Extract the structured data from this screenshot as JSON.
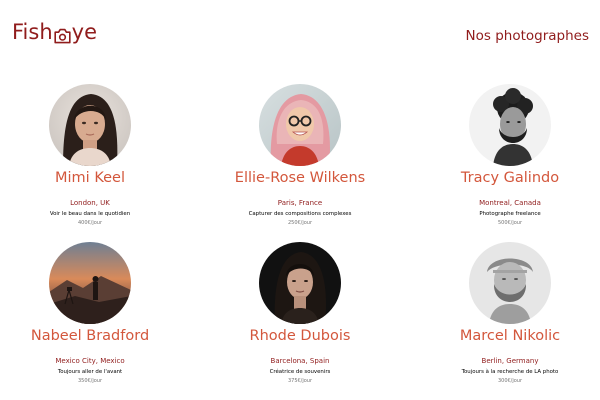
{
  "header": {
    "logo_text_before": "Fish",
    "logo_text_after": "ye",
    "logo_icon": "camera-icon",
    "tagline": "Nos photographes"
  },
  "photographers": [
    {
      "name": "Mimi Keel",
      "location": "London, UK",
      "tagline": "Voir le beau dans le quotidien",
      "price": "400€/jour",
      "portrait": "portrait-young-woman"
    },
    {
      "name": "Ellie-Rose Wilkens",
      "location": "Paris, France",
      "tagline": "Capturer des compositions complexes",
      "price": "250€/jour",
      "portrait": "portrait-woman-glasses-pink-hair"
    },
    {
      "name": "Tracy Galindo",
      "location": "Montreal, Canada",
      "tagline": "Photographe freelance",
      "price": "500€/jour",
      "portrait": "portrait-man-curly-beard-bw"
    },
    {
      "name": "Nabeel Bradford",
      "location": "Mexico City, Mexico",
      "tagline": "Toujours aller de l'avant",
      "price": "350€/jour",
      "portrait": "landscape-photographer-sunset"
    },
    {
      "name": "Rhode Dubois",
      "location": "Barcelona, Spain",
      "tagline": "Créatrice de souvenirs",
      "price": "375€/jour",
      "portrait": "portrait-woman-dark-hair"
    },
    {
      "name": "Marcel Nikolic",
      "location": "Berlin, Germany",
      "tagline": "Toujours à la recherche de LA photo",
      "price": "300€/jour",
      "portrait": "portrait-man-beard-bw"
    }
  ],
  "colors": {
    "brand_dark": "#901C1C",
    "brand_accent": "#D3573C",
    "price_grey": "#757575"
  }
}
